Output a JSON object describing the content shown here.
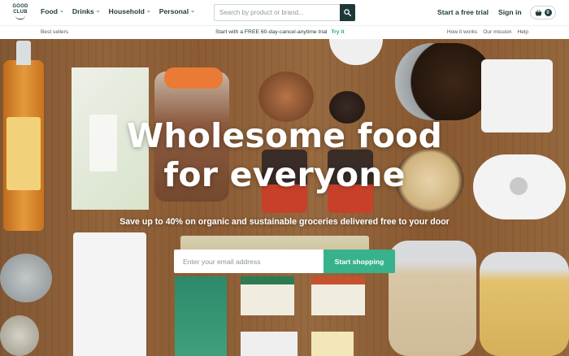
{
  "brand": {
    "logo_line1": "GOOD",
    "logo_line2": "CLUB"
  },
  "nav": {
    "menu": [
      {
        "label": "Food"
      },
      {
        "label": "Drinks"
      },
      {
        "label": "Household"
      },
      {
        "label": "Personal"
      }
    ],
    "search_placeholder": "Search by product or brand...",
    "trial_link": "Start a free trial",
    "signin_link": "Sign in",
    "basket_count": "0"
  },
  "subnav": {
    "bestsellers": "Best sellers",
    "promo_text": "Start with a FREE 60-day-cancel-anytime trial",
    "promo_link": "Try it",
    "links": [
      "How it works",
      "Our mission",
      "Help"
    ]
  },
  "hero": {
    "title_line1": "Wholesome food",
    "title_line2": "for everyone",
    "subtitle": "Save up to 40% on organic and sustainable groceries delivered free to your door",
    "email_placeholder": "Enter your email address",
    "cta_label": "Start shopping"
  },
  "colors": {
    "accent": "#38b28c",
    "dark": "#1e3838",
    "link_green": "#2aa383"
  }
}
